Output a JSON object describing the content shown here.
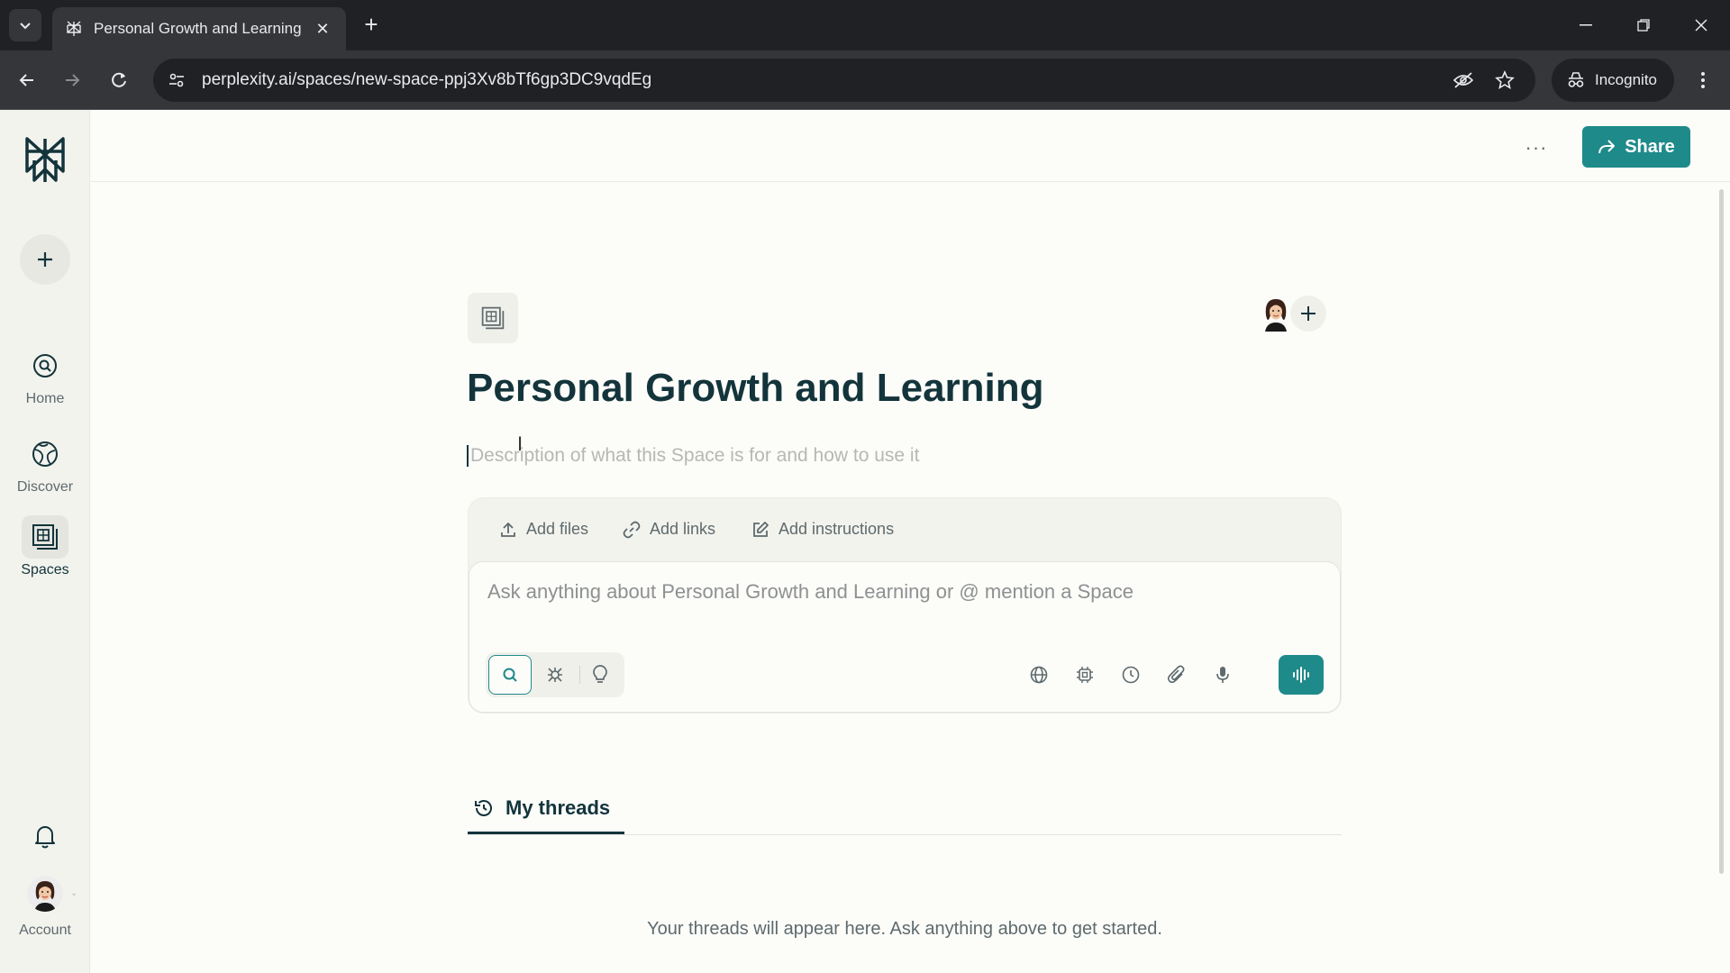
{
  "browser": {
    "tab_title": "Personal Growth and Learning",
    "url": "perplexity.ai/spaces/new-space-ppj3Xv8bTf6gp3DC9vqdEg",
    "incognito_label": "Incognito"
  },
  "sidebar": {
    "items": [
      {
        "label": "Home",
        "icon": "search-circle-icon"
      },
      {
        "label": "Discover",
        "icon": "globe-icon"
      },
      {
        "label": "Spaces",
        "icon": "spaces-icon"
      }
    ],
    "account_label": "Account"
  },
  "header": {
    "share_label": "Share",
    "more_label": "···"
  },
  "space": {
    "title": "Personal Growth and Learning",
    "description_placeholder": "Description of what this Space is for and how to use it"
  },
  "composer": {
    "actions": [
      "Add files",
      "Add links",
      "Add instructions"
    ],
    "placeholder": "Ask anything about Personal Growth and Learning or @ mention a Space",
    "modes": [
      "search-icon",
      "research-icon",
      "lightbulb-icon"
    ],
    "tools": [
      "globe-icon",
      "chip-icon",
      "clock-icon",
      "paperclip-icon",
      "microphone-icon"
    ],
    "accent_color": "#1f8a8a"
  },
  "threads": {
    "tab_label": "My threads",
    "empty_message": "Your threads will appear here. Ask anything above to get started."
  }
}
